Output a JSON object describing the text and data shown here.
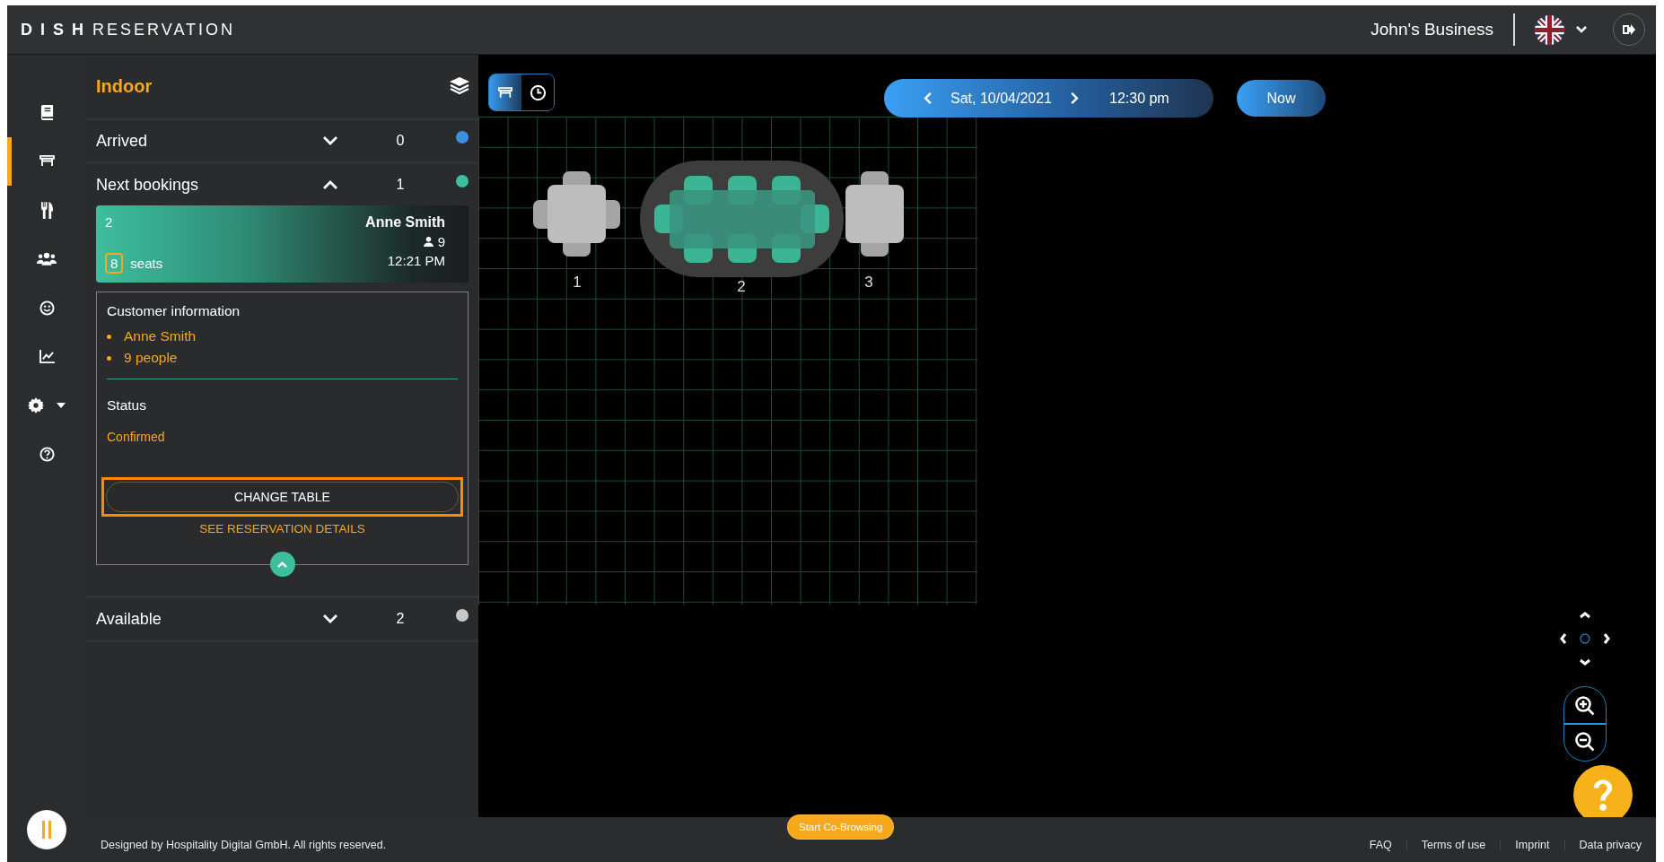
{
  "header": {
    "brand_bold": "D I S H",
    "brand_rest": "RESERVATION",
    "business": "John's Business"
  },
  "nav": [
    {
      "kind": "book",
      "selected": false
    },
    {
      "kind": "table",
      "selected": true
    },
    {
      "kind": "cutlery",
      "selected": false
    },
    {
      "kind": "people",
      "selected": false
    },
    {
      "kind": "smiley",
      "selected": false
    },
    {
      "kind": "chart",
      "selected": false
    },
    {
      "kind": "gear",
      "selected": false
    },
    {
      "kind": "help",
      "selected": false
    }
  ],
  "panel": {
    "title": "Indoor",
    "sections": [
      {
        "label": "Arrived",
        "expanded": false,
        "count": "0",
        "color": "#3b8fe0"
      },
      {
        "label": "Next bookings",
        "expanded": true,
        "count": "1",
        "color": "#3cbf9c",
        "bookings": [
          {
            "table": "2",
            "seats": "8",
            "seats_label": "seats",
            "name": "Anne Smith",
            "guests": "9",
            "time": "12:21 PM",
            "info_heading": "Customer information",
            "info": [
              "Anne Smith",
              "9 people"
            ],
            "status_heading": "Status",
            "status": "Confirmed",
            "action": "CHANGE TABLE",
            "link": "SEE RESERVATION DETAILS"
          }
        ]
      },
      {
        "label": "Available",
        "expanded": false,
        "count": "2",
        "color": "#c8c8c8"
      }
    ]
  },
  "view_toggle": [
    {
      "kind": "table",
      "selected": true
    },
    {
      "kind": "clock",
      "selected": false
    }
  ],
  "date_bar": {
    "date": "Sat, 10/04/2021",
    "time": "12:30 pm",
    "now": "Now"
  },
  "floor": {
    "tables": [
      {
        "label": "1",
        "kind": "square",
        "selected": false
      },
      {
        "label": "2",
        "kind": "oval",
        "selected": true
      },
      {
        "label": "3",
        "kind": "square",
        "selected": false
      }
    ]
  },
  "footer": {
    "copyright": "Designed by Hospitality Digital GmbH. All rights reserved.",
    "cobrowse": "Start Co-Browsing",
    "links": [
      "FAQ",
      "Terms of use",
      "Imprint",
      "Data privacy"
    ]
  }
}
